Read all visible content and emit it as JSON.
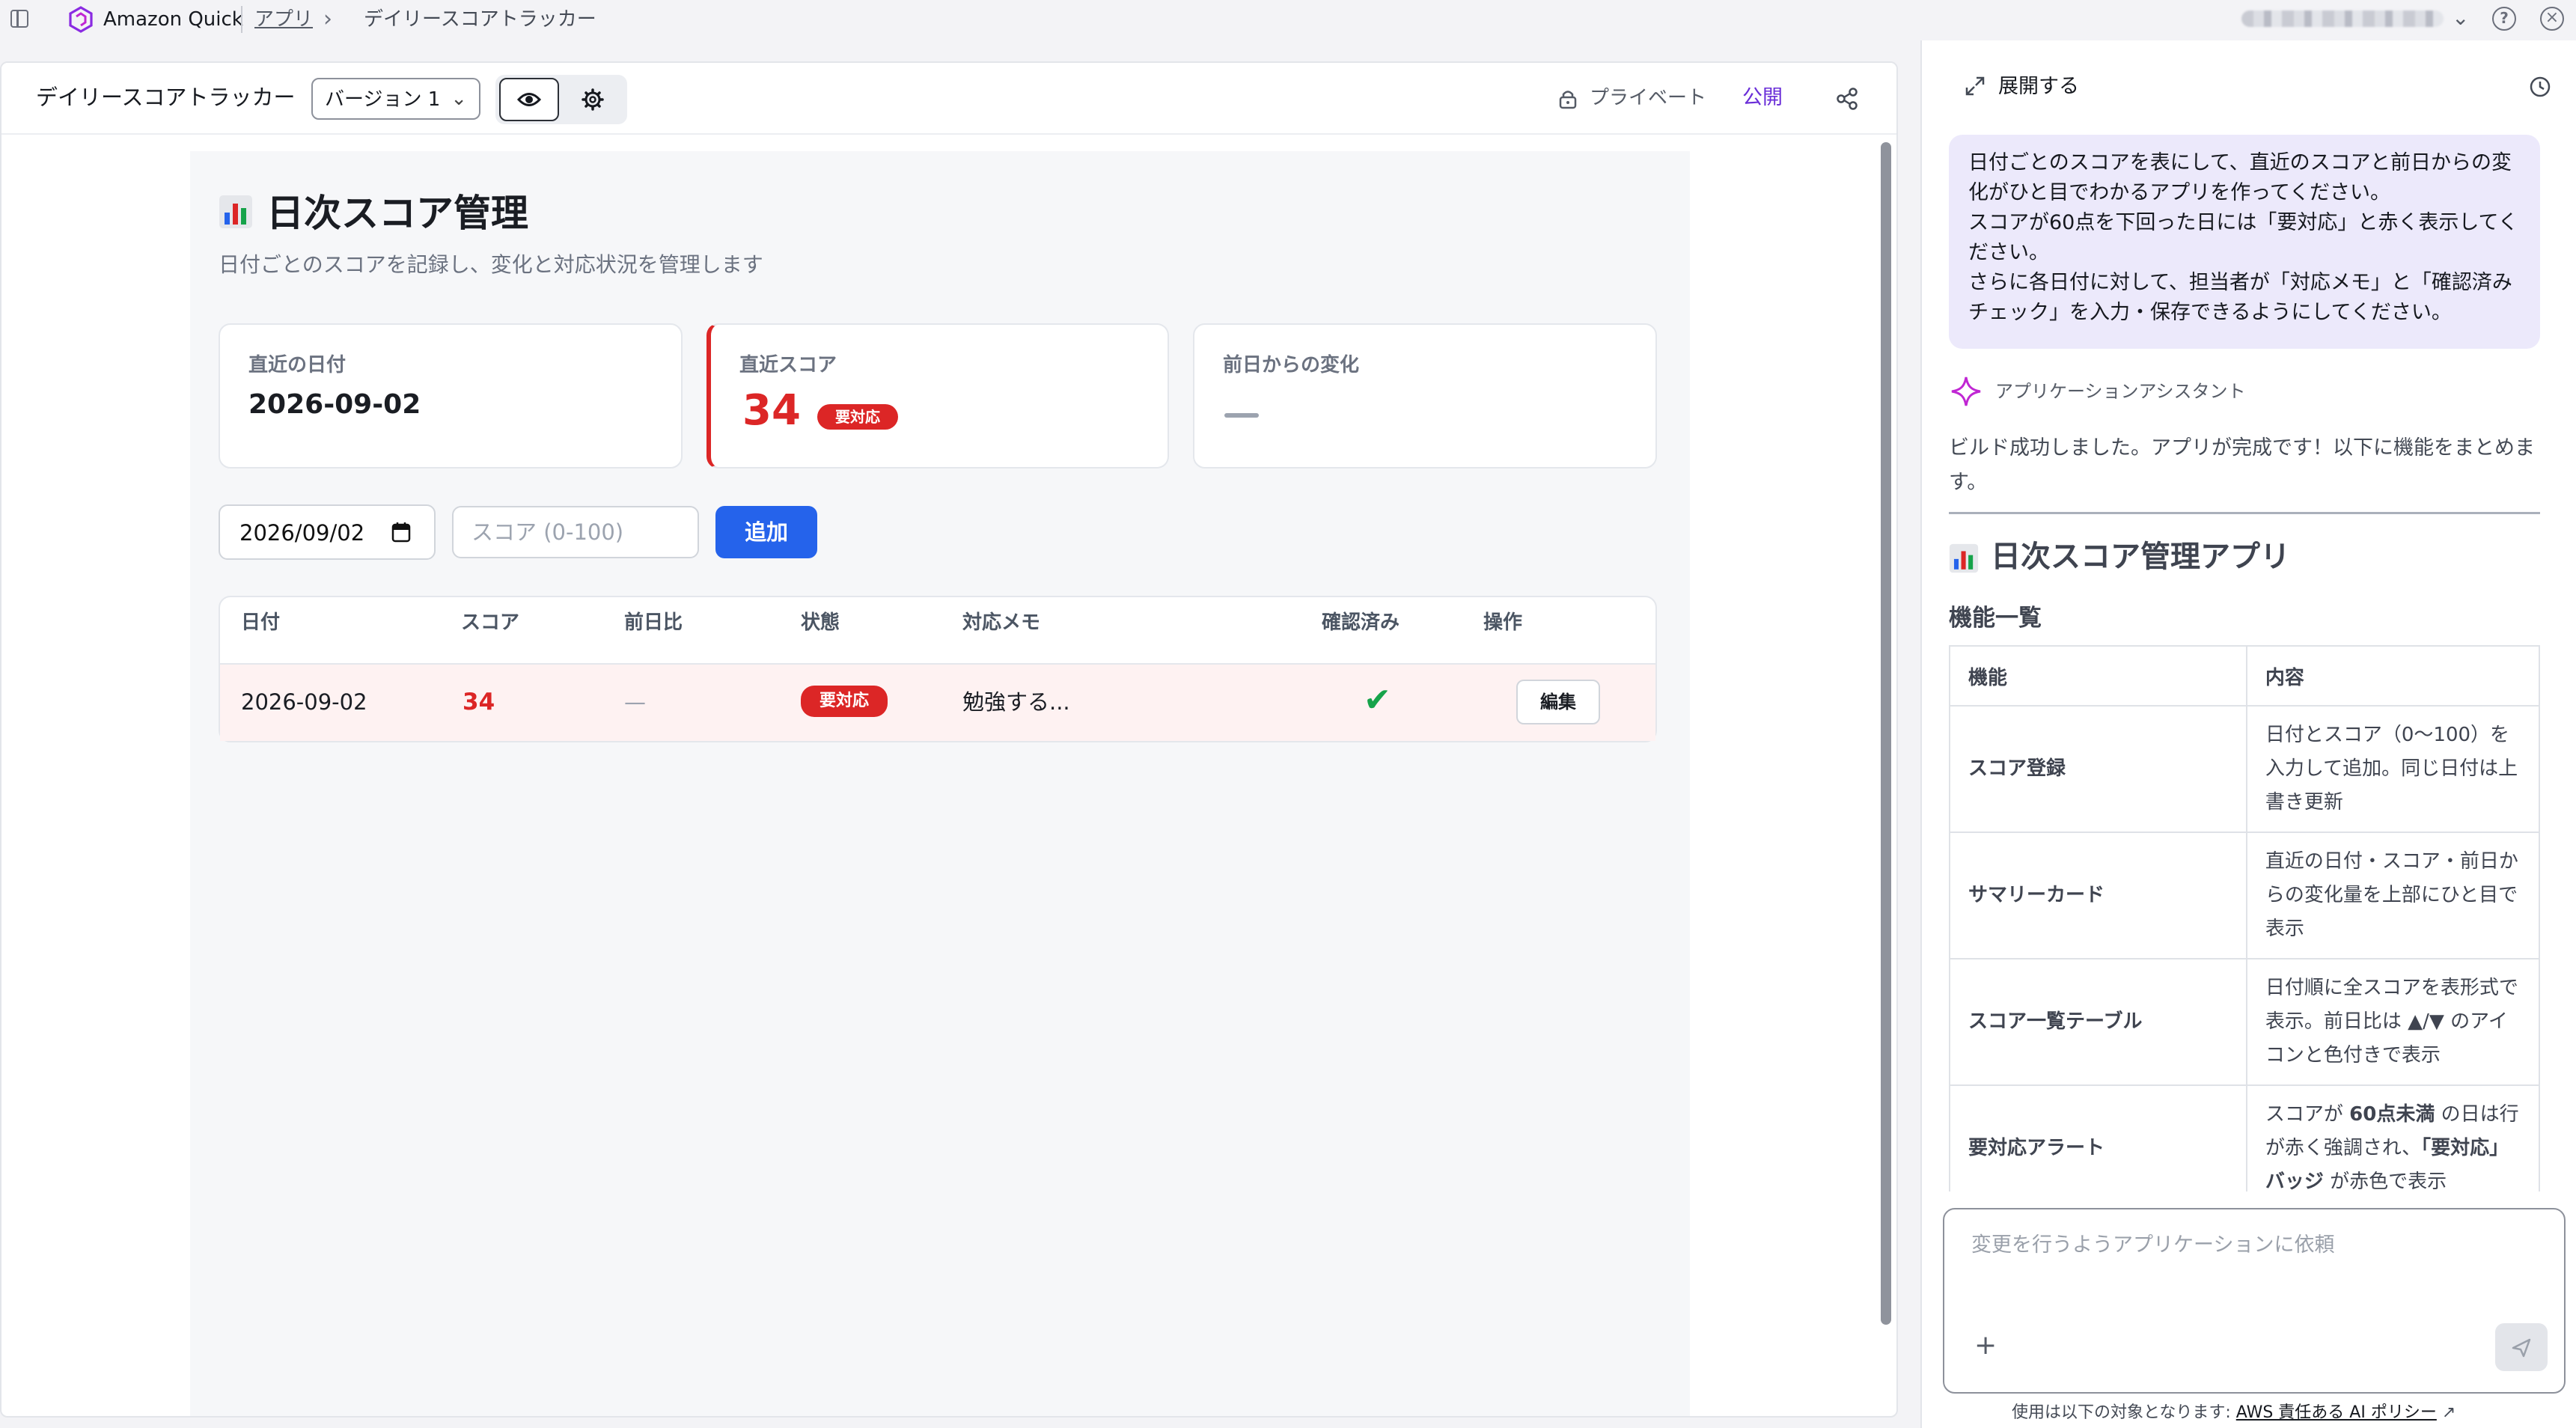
{
  "topbar": {
    "brand": "Amazon Quick",
    "breadcrumb_app": "アプリ",
    "breadcrumb_current": "デイリースコアトラッカー"
  },
  "editor": {
    "app_title": "デイリースコアトラッカー",
    "version": "バージョン 1",
    "private_label": "プライベート",
    "publish_label": "公開"
  },
  "page": {
    "title": "日次スコア管理",
    "subtitle": "日付ごとのスコアを記録し、変化と対応状況を管理します",
    "cards": {
      "recent_date_label": "直近の日付",
      "recent_date": "2026-09-02",
      "recent_score_label": "直近スコア",
      "recent_score": "34",
      "recent_score_badge": "要対応",
      "change_label": "前日からの変化"
    },
    "form": {
      "date_value": "2026/09/02",
      "score_placeholder": "スコア (0-100)",
      "add_label": "追加"
    },
    "table": {
      "headers": [
        "日付",
        "スコア",
        "前日比",
        "状態",
        "対応メモ",
        "確認済み",
        "操作"
      ],
      "rows": [
        {
          "date": "2026-09-02",
          "score": "34",
          "change": "—",
          "status": "要対応",
          "memo": "勉強する...",
          "confirmed": "✔",
          "action": "編集"
        }
      ]
    },
    "colors": {
      "alert": "#dc2626",
      "primary": "#2563eb",
      "confirm": "#16a34a",
      "publish": "#6a2ed8"
    }
  },
  "assistant": {
    "expand_label": "展開する",
    "user_message": "日付ごとのスコアを表にして、直近のスコアと前日からの変化がひと目でわかるアプリを作ってください。\nスコアが60点を下回った日には「要対応」と赤く表示してください。\nさらに各日付に対して、担当者が「対応メモ」と「確認済みチェック」を入力・保存できるようにしてください。",
    "assistant_name": "アプリケーションアシスタント",
    "assistant_message": "ビルド成功しました。アプリが完成です！以下に機能をまとめます。",
    "response_title": "日次スコア管理アプリ",
    "response_subtitle": "機能一覧",
    "feature_table": {
      "headers": [
        "機能",
        "内容"
      ],
      "rows": [
        {
          "name": "スコア登録",
          "desc": "日付とスコア（0〜100）を入力して追加。同じ日付は上書き更新"
        },
        {
          "name": "サマリーカード",
          "desc": "直近の日付・スコア・前日からの変化量を上部にひと目で表示"
        },
        {
          "name": "スコア一覧テーブル",
          "desc": "日付順に全スコアを表形式で表示。前日比は ▲/▼ のアイコンと色付きで表示"
        },
        {
          "name": "要対応アラート",
          "desc_pre": "スコアが ",
          "desc_b1": "60点未満",
          "desc_mid": " の日は行が赤く強調され、",
          "desc_b2": "「要対応」バッジ",
          "desc_post": " が赤色で表示"
        }
      ]
    },
    "composer_placeholder": "変更を行うようアプリケーションに依頼",
    "footer_prefix": "使用は以下の対象となります: ",
    "footer_link": "AWS 責任ある AI ポリシー"
  }
}
